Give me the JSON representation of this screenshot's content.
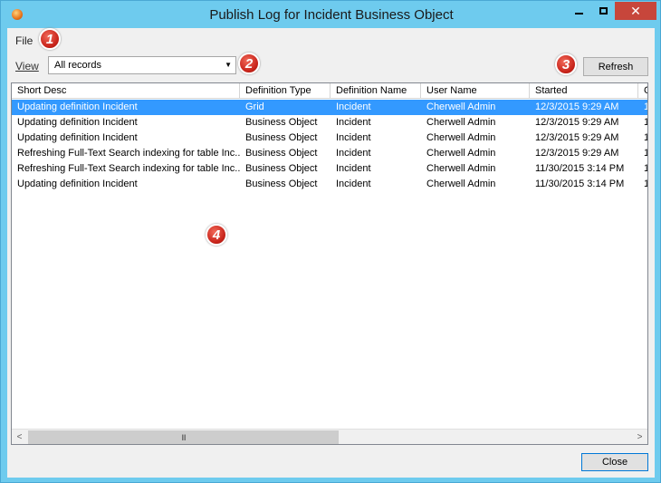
{
  "window": {
    "title": "Publish Log for Incident Business Object",
    "close_glyph": "✕"
  },
  "menu": {
    "file_label": "File"
  },
  "view": {
    "label": "View",
    "selected": "All records",
    "arrow": "▼"
  },
  "toolbar": {
    "refresh_label": "Refresh"
  },
  "badges": [
    "1",
    "2",
    "3",
    "4"
  ],
  "grid": {
    "columns": [
      "Short Desc",
      "Definition Type",
      "Definition Name",
      "User Name",
      "Started",
      "C"
    ],
    "rows": [
      [
        "Updating definition Incident",
        "Grid",
        "Incident",
        "Cherwell Admin",
        "12/3/2015  9:29 AM",
        "1"
      ],
      [
        "Updating definition Incident",
        "Business Object",
        "Incident",
        "Cherwell Admin",
        "12/3/2015  9:29 AM",
        "1"
      ],
      [
        "Updating definition Incident",
        "Business Object",
        "Incident",
        "Cherwell Admin",
        "12/3/2015  9:29 AM",
        "1"
      ],
      [
        "Refreshing Full-Text Search indexing for table Inc...",
        "Business Object",
        "Incident",
        "Cherwell Admin",
        "12/3/2015  9:29 AM",
        "1"
      ],
      [
        "Refreshing Full-Text Search indexing for table Inc...",
        "Business Object",
        "Incident",
        "Cherwell Admin",
        "11/30/2015  3:14 PM",
        "1"
      ],
      [
        "Updating definition Incident",
        "Business Object",
        "Incident",
        "Cherwell Admin",
        "11/30/2015  3:14 PM",
        "1"
      ]
    ],
    "selected_row": 0
  },
  "scrollbar": {
    "left_arrow": "<",
    "right_arrow": ">",
    "thumb_grip": "III"
  },
  "footer": {
    "close_label": "Close"
  },
  "colors": {
    "titlebar": "#6ecbee",
    "selection": "#3399ff",
    "badge": "#c8231a"
  }
}
